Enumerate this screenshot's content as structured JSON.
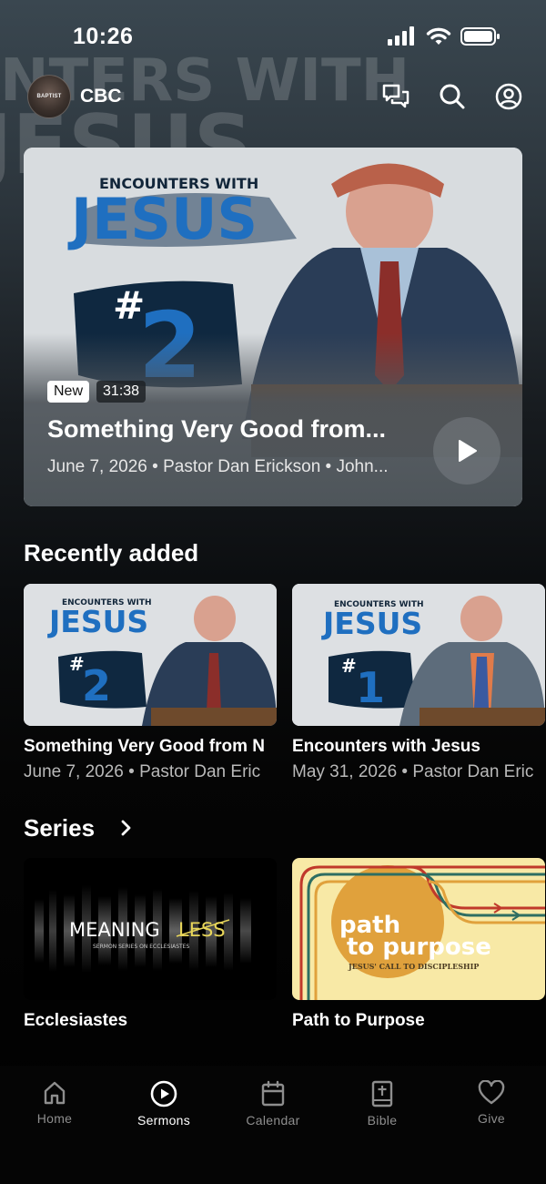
{
  "status_bar": {
    "time": "10:26"
  },
  "header": {
    "church_name": "CBC",
    "logo_text": "BAPTIST"
  },
  "hero": {
    "badge_new": "New",
    "duration": "31:38",
    "title": "Something Very Good from...",
    "subtitle": "June 7, 2026 • Pastor Dan Erickson • John...",
    "art_line1": "ENCOUNTERS WITH",
    "art_line2": "JESUS",
    "art_number_hash": "#",
    "art_number": "2"
  },
  "recently_added": {
    "title": "Recently added",
    "items": [
      {
        "title": "Something Very Good from N",
        "subtitle": "June 7, 2026 • Pastor Dan Eric",
        "art_line1": "ENCOUNTERS WITH",
        "art_line2": "JESUS",
        "art_number": "2"
      },
      {
        "title": "Encounters with Jesus",
        "subtitle": "May 31, 2026 • Pastor Dan Eric",
        "art_line1": "ENCOUNTERS WITH",
        "art_line2": "JESUS",
        "art_number": "1"
      }
    ]
  },
  "series": {
    "title": "Series",
    "items": [
      {
        "title": "Ecclesiastes",
        "art_main": "MEANING",
        "art_struck": "LESS",
        "art_sub": "SERMON SERIES ON ECCLESIASTES"
      },
      {
        "title": "Path to Purpose",
        "art_line1": "path",
        "art_line2": "to purpose",
        "art_sub": "JESUS' CALL TO DISCIPLESHIP"
      }
    ]
  },
  "tabs": [
    {
      "label": "Home",
      "icon": "home-icon"
    },
    {
      "label": "Sermons",
      "icon": "play-circle-icon",
      "active": true
    },
    {
      "label": "Calendar",
      "icon": "calendar-icon"
    },
    {
      "label": "Bible",
      "icon": "bible-icon"
    },
    {
      "label": "Give",
      "icon": "heart-icon"
    }
  ],
  "colors": {
    "accent_blue": "#1f6fc0",
    "series_yellow": "#f8e9a6",
    "series_orange": "#e0a13c"
  }
}
